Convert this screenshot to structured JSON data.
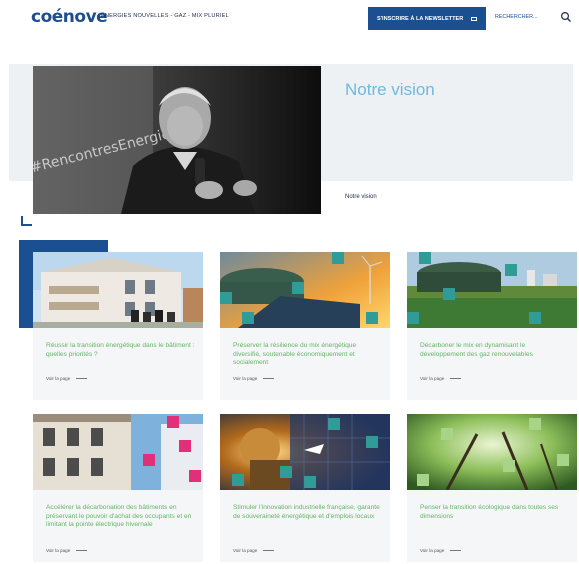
{
  "header": {
    "logo": "coénove",
    "tagline": "ÉNERGIES NOUVELLES - GAZ - MIX PLURIEL",
    "newsletter_label": "S'INSCRIRE À LA NEWSLETTER",
    "search_label": "RECHERCHER..."
  },
  "hero": {
    "title": "Notre vision",
    "link": "Notre vision",
    "photo_sign": "#RencontresEnergie"
  },
  "cards": [
    {
      "title": "Réussir la transition énergétique dans le bâtiment : quelles priorités ?",
      "more": "Voir la page"
    },
    {
      "title": "Préserver la résilience du mix énergétique diversifié, soutenable économiquement et socialement",
      "more": "Voir la page"
    },
    {
      "title": "Décarboner le mix en dynamisant le développement des gaz renouvelables",
      "more": "Voir la page"
    },
    {
      "title": "Accélérer la décarbonation des bâtiments en préservant le pouvoir d'achat des occupants et en limitant la pointe électrique hivernale",
      "more": "Voir la page"
    },
    {
      "title": "Stimuler l'innovation industrielle française, garante de souveraineté énergétique et d'emplois locaux",
      "more": "Voir la page"
    },
    {
      "title": "Penser la transition écologique dans toutes ses dimensions",
      "more": "Voir la page"
    }
  ],
  "colors": {
    "brand_blue": "#1a4f92",
    "accent_light_blue": "#6eb9df",
    "green_text": "#64b469",
    "magenta_square": "#e0307a",
    "teal_square": "#2f9c97"
  }
}
